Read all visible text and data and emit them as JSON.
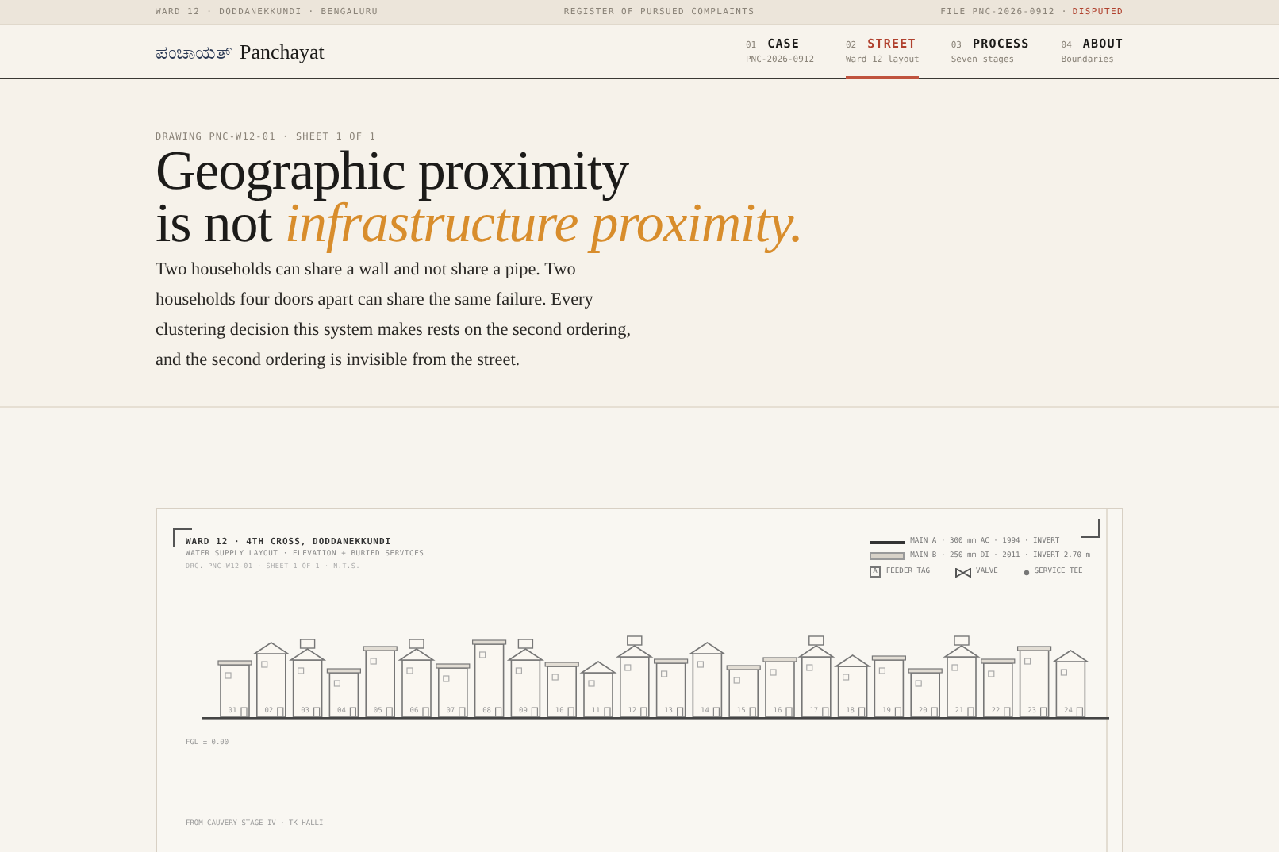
{
  "top_bar": {
    "left": "WARD 12 · DODDANEKKUNDI · BENGALURU",
    "center": "REGISTER OF PURSUED COMPLAINTS",
    "file": "FILE PNC-2026-0912 ·",
    "status": "DISPUTED"
  },
  "logo": {
    "script": "ಪಂಚಾಯತ್",
    "name": "Panchayat"
  },
  "nav": [
    {
      "number": "01",
      "label": "CASE",
      "sub": "PNC-2026-0912",
      "selected": false
    },
    {
      "number": "02",
      "label": "STREET",
      "sub": "Ward 12 layout",
      "selected": true
    },
    {
      "number": "03",
      "label": "PROCESS",
      "sub": "Seven stages",
      "selected": false
    },
    {
      "number": "04",
      "label": "ABOUT",
      "sub": "Boundaries",
      "selected": false
    }
  ],
  "hero": {
    "kicker": "DRAWING PNC-W12-01 · SHEET 1 OF 1",
    "title_line1": "Geographic proximity",
    "title_line2_plain": "is not",
    "title_line2_accent": "infrastructure proximity.",
    "body": "Two households can share a wall and not share a pipe. Two households four doors apart can share the same failure. Every clustering decision this system makes rests on the second ordering, and the second ordering is invisible from the street."
  },
  "drawing": {
    "title": "WARD 12 · 4TH CROSS, DODDANEKKUNDI",
    "subtitle": "WATER SUPPLY LAYOUT · ELEVATION + BURIED SERVICES",
    "reference": "DRG. PNC-W12-01 · SHEET 1 OF 1 · N.T.S.",
    "legend": [
      {
        "kind": "main-a",
        "label": "MAIN A · 300 mm AC · 1994 · INVERT"
      },
      {
        "kind": "main-b",
        "label": "MAIN B · 250 mm DI · 2011 · INVERT 2.70 m"
      }
    ],
    "symbols": [
      {
        "kind": "tag",
        "glyph": "A",
        "label": "FEEDER TAG"
      },
      {
        "kind": "valve",
        "label": "VALVE"
      },
      {
        "kind": "tee",
        "label": "SERVICE TEE"
      }
    ],
    "houses": [
      {
        "number": "01",
        "kind": "flat"
      },
      {
        "number": "02",
        "kind": "gable"
      },
      {
        "number": "03",
        "kind": "tank"
      },
      {
        "number": "04",
        "kind": "flat"
      },
      {
        "number": "05",
        "kind": "flat"
      },
      {
        "number": "06",
        "kind": "tank"
      },
      {
        "number": "07",
        "kind": "flat"
      },
      {
        "number": "08",
        "kind": "flat"
      },
      {
        "number": "09",
        "kind": "tank"
      },
      {
        "number": "10",
        "kind": "flat"
      },
      {
        "number": "11",
        "kind": "gable"
      },
      {
        "number": "12",
        "kind": "tank"
      },
      {
        "number": "13",
        "kind": "flat"
      },
      {
        "number": "14",
        "kind": "gable"
      },
      {
        "number": "15",
        "kind": "flat"
      },
      {
        "number": "16",
        "kind": "flat"
      },
      {
        "number": "17",
        "kind": "tank"
      },
      {
        "number": "18",
        "kind": "gable"
      },
      {
        "number": "19",
        "kind": "flat"
      },
      {
        "number": "20",
        "kind": "flat"
      },
      {
        "number": "21",
        "kind": "tank"
      },
      {
        "number": "22",
        "kind": "flat"
      },
      {
        "number": "23",
        "kind": "flat"
      },
      {
        "number": "24",
        "kind": "gable"
      }
    ],
    "ground_level": "FGL ± 0.00",
    "source": "FROM CAUVERY STAGE IV · TK HALLI"
  }
}
